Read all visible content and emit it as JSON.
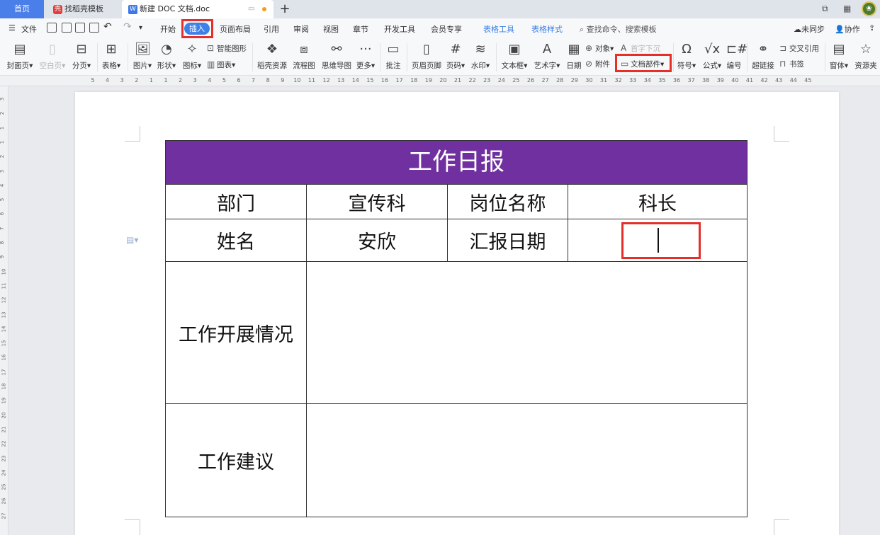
{
  "tabs": {
    "home": "首页",
    "stencil": "找稻壳模板",
    "doc": "新建 DOC 文档.doc",
    "new_tab": "+"
  },
  "menu": {
    "file": "文件",
    "items": [
      "开始",
      "插入",
      "页面布局",
      "引用",
      "审阅",
      "视图",
      "章节",
      "开发工具",
      "会员专享"
    ],
    "context_items": [
      "表格工具",
      "表格样式"
    ],
    "search": "查找命令、搜索模板",
    "sync": "未同步",
    "collab": "协作",
    "active": "插入"
  },
  "ribbon": {
    "cover": "封面页",
    "blank": "空白页",
    "pagebreak": "分页",
    "table": "表格",
    "picture": "图片",
    "shape": "形状",
    "icon": "图标",
    "smartart": "智能图形",
    "chart": "图表",
    "docer": "稻壳资源",
    "flow": "流程图",
    "mind": "思维导图",
    "more": "更多",
    "comment": "批注",
    "header": "页眉页脚",
    "pagenum": "页码",
    "watermark": "水印",
    "textbox": "文本框",
    "wordart": "艺术字",
    "date": "日期",
    "object": "对象",
    "attach": "附件",
    "dropcap": "首字下沉",
    "docpart": "文档部件",
    "symbol": "符号",
    "formula": "公式",
    "number": "编号",
    "hyperlink": "超链接",
    "crossref": "交叉引用",
    "bookmark": "书签",
    "form": "窗体",
    "resource": "资源夹"
  },
  "ruler": {
    "h_left": [
      "5",
      "4",
      "3",
      "2",
      "1",
      "1",
      "2",
      "3",
      "4",
      "5",
      "6",
      "7",
      "8",
      "9",
      "10",
      "11",
      "12",
      "13",
      "14",
      "15",
      "16",
      "17",
      "18",
      "19",
      "20",
      "21",
      "22",
      "23",
      "24",
      "25",
      "26",
      "27",
      "28",
      "29",
      "30",
      "31",
      "32",
      "33",
      "34",
      "35",
      "36",
      "37",
      "38",
      "39",
      "40",
      "41",
      "42",
      "43",
      "44",
      "45"
    ],
    "v": [
      "3",
      "2",
      "1",
      "1",
      "2",
      "3",
      "4",
      "5",
      "6",
      "7",
      "8",
      "9",
      "10",
      "11",
      "12",
      "13",
      "14",
      "15",
      "16",
      "17",
      "18",
      "19",
      "20",
      "21",
      "22",
      "23",
      "24",
      "25",
      "26",
      "27"
    ]
  },
  "table": {
    "title": "工作日报",
    "row1": [
      "部门",
      "宣传科",
      "岗位名称",
      "科长"
    ],
    "row2": [
      "姓名",
      "安欣",
      "汇报日期",
      ""
    ],
    "row3_label": "工作开展情况",
    "row3_value": "",
    "row4_label": "工作建议",
    "row4_value": "",
    "title_color": "#7030a0"
  },
  "colors": {
    "accent": "#3d80e8",
    "highlight": "#e5302a"
  }
}
